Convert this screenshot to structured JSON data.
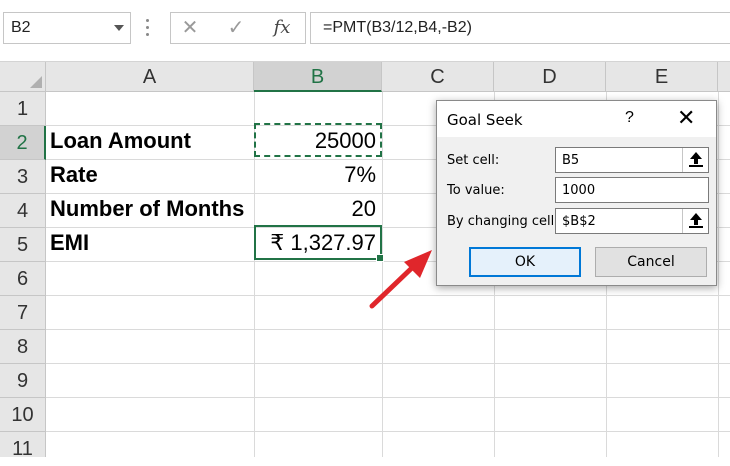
{
  "name_box": {
    "value": "B2"
  },
  "formula_bar": {
    "cancel_glyph": "✕",
    "enter_glyph": "✓",
    "fx_glyph": "fx",
    "formula": "=PMT(B3/12,B4,-B2)"
  },
  "columns": [
    "A",
    "B",
    "C",
    "D",
    "E"
  ],
  "rows": [
    "1",
    "2",
    "3",
    "4",
    "5",
    "6",
    "7",
    "8",
    "9",
    "10",
    "11"
  ],
  "cells": {
    "A2": "Loan Amount",
    "B2": "25000",
    "A3": "Rate",
    "B3": "7%",
    "A4": "Number of Months",
    "B4": "20",
    "A5": "EMI",
    "B5": "₹ 1,327.97"
  },
  "goal_seek": {
    "title": "Goal Seek",
    "help": "?",
    "close": "✕",
    "set_cell_label": "Set cell:",
    "set_cell_value": "B5",
    "to_value_label": "To value:",
    "to_value_value": "1000",
    "by_changing_label": "By changing cell:",
    "by_changing_value": "$B$2",
    "ok_label": "OK",
    "cancel_label": "Cancel"
  },
  "colors": {
    "excel_green": "#217346",
    "annotation_arrow": "#e0262b",
    "ok_focus": "#0078d7"
  }
}
